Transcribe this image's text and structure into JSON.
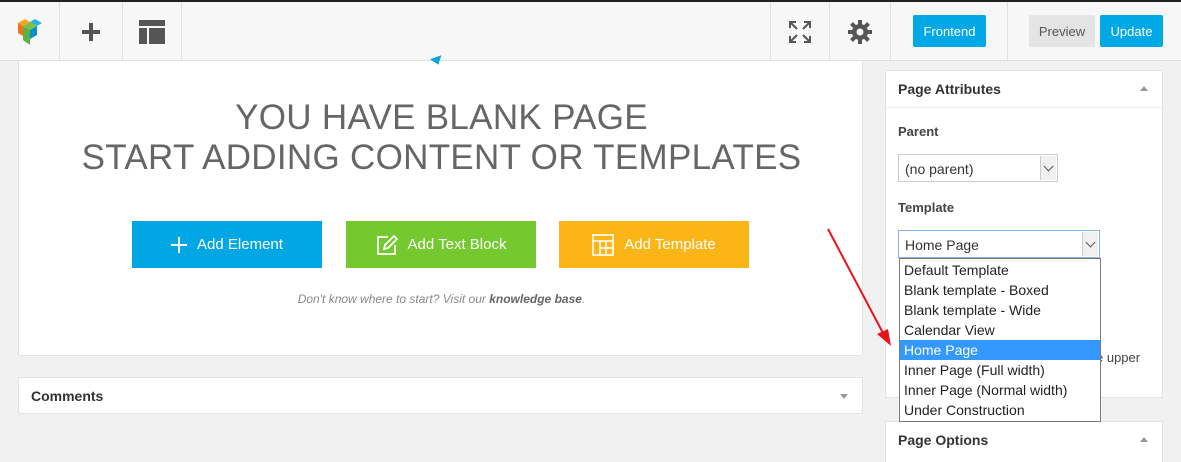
{
  "toolbar": {
    "frontend_label": "Frontend",
    "preview_label": "Preview",
    "update_label": "Update",
    "icons": [
      "vc-logo-icon",
      "plus-icon",
      "layout-icon",
      "fullscreen-icon",
      "gear-icon"
    ]
  },
  "main": {
    "heading_line1": "YOU HAVE BLANK PAGE",
    "heading_line2": "START ADDING CONTENT OR TEMPLATES",
    "add_element_label": "Add Element",
    "add_text_block_label": "Add Text Block",
    "add_template_label": "Add Template",
    "help_prefix": "Don't know where to start? Visit our ",
    "help_link": "knowledge base",
    "help_suffix": "."
  },
  "comments": {
    "title": "Comments"
  },
  "sidebar": {
    "page_attributes": {
      "title": "Page Attributes",
      "parent_label": "Parent",
      "parent_value": "(no parent)",
      "template_label": "Template",
      "template_value": "Home Page",
      "partial_text": "e upper"
    },
    "page_options": {
      "title": "Page Options"
    }
  },
  "template_dropdown": {
    "options": [
      "Default Template",
      "Blank template - Boxed",
      "Blank template - Wide",
      "Calendar View",
      "Home Page",
      "Inner Page (Full width)",
      "Inner Page (Normal width)",
      "Under Construction"
    ],
    "selected_index": 4
  },
  "colors": {
    "accent_blue": "#00a8e6",
    "green": "#73c92e",
    "orange": "#fbb516",
    "annotation_red": "#e8141b",
    "selection_blue": "#3399ff"
  }
}
